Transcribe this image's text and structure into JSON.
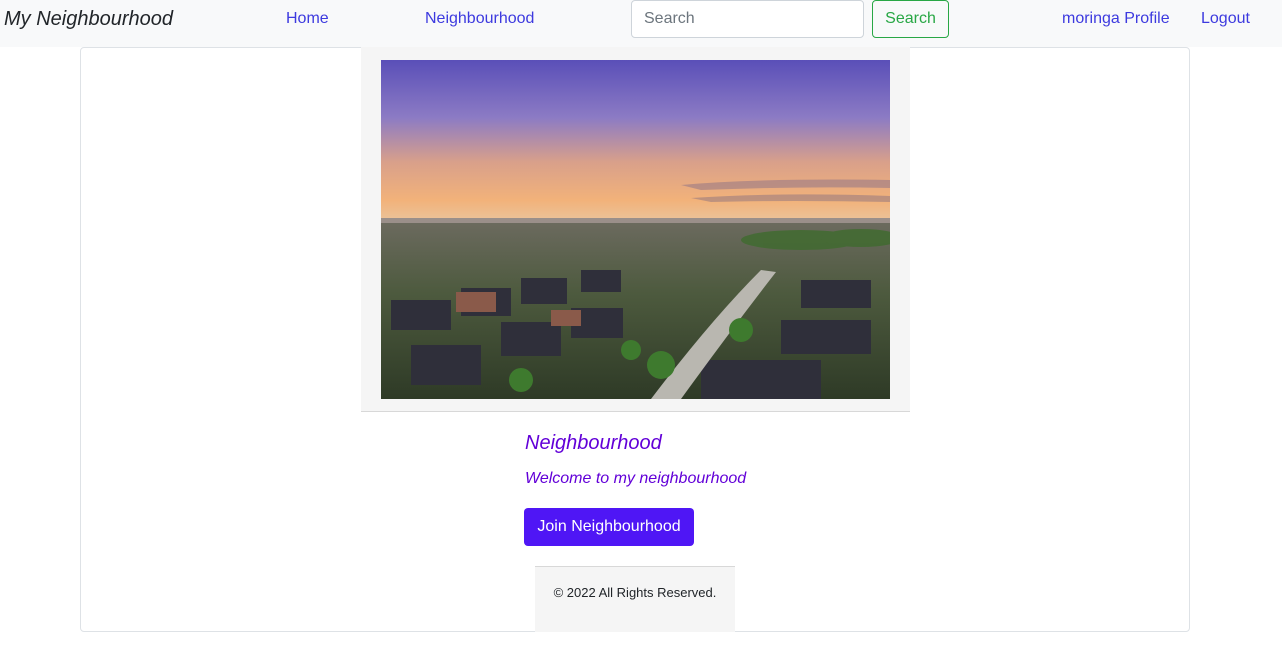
{
  "navbar": {
    "brand": "My Neighbourhood",
    "links": {
      "home": "Home",
      "neighbourhood": "Neighbourhood",
      "profile": "moringa Profile",
      "logout": "Logout"
    },
    "search": {
      "placeholder": "Search",
      "button_label": "Search"
    }
  },
  "neighbourhood": {
    "name": "Neighbourhood",
    "description": "Welcome to my neighbourhood",
    "join_label": "Join Neighbourhood"
  },
  "footer": {
    "text": "© 2022 All Rights Reserved."
  },
  "colors": {
    "navbar_bg": "#f8f9fa",
    "link": "#3d3adf",
    "search_button": "#28a745",
    "accent_text": "#6200d8",
    "join_button": "#4f16f5"
  }
}
